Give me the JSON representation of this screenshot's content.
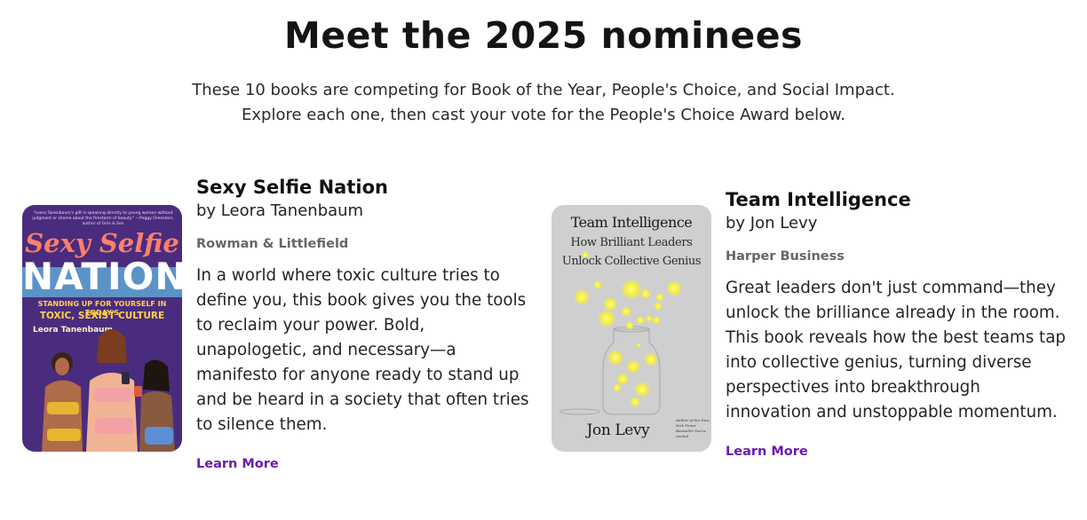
{
  "header": {
    "title": "Meet the 2025 nominees",
    "intro": "These 10 books are competing for Book of the Year, People's Choice, and Social Impact. Explore each one, then cast your vote for the People's Choice Award below."
  },
  "books": [
    {
      "title": "Sexy Selfie Nation",
      "author": "by Leora Tanenbaum",
      "publisher": "Rowman & Littlefield",
      "description": "In a world where toxic culture tries to define you, this book gives you the tools to reclaim your power. Bold, unapologetic, and necessary—a manifesto for anyone ready to stand up and be heard in a society that often tries to silence them.",
      "link_label": "Learn More",
      "cover": {
        "quote": "\"Leora Tanenbaum's gift is speaking directly to young women without judgment or shame about the firestorm of beauty.\" —Peggy Orenstein, author of Girls & Sex",
        "title_line1": "Sexy Selfie",
        "title_line2": "NATION",
        "subtitle_line1": "STANDING UP FOR YOURSELF IN TODAY'S",
        "subtitle_line2": "TOXIC, SEXIST CULTURE",
        "author": "Leora Tanenbaum"
      }
    },
    {
      "title": "Team Intelligence",
      "author": "by Jon Levy",
      "publisher": "Harper Business",
      "description": "Great leaders don't just command—they unlock the brilliance already in the room. This book reveals how the best teams tap into collective genius, turning diverse perspectives into breakthrough innovation and unstoppable momentum.",
      "link_label": "Learn More",
      "cover": {
        "title": "Team Intelligence",
        "subtitle_line1": "How Brilliant Leaders",
        "subtitle_line2": "Unlock Collective Genius",
        "author": "Jon Levy",
        "blurb": "Author of the New York Times Bestseller You're Invited"
      }
    }
  ],
  "colors": {
    "link": "#6a1bb0",
    "cover1_bg": "#4a2c7e",
    "cover1_band": "#5b93c7",
    "cover2_bg": "#cfcfcf",
    "firefly": "#f4ef3c"
  }
}
